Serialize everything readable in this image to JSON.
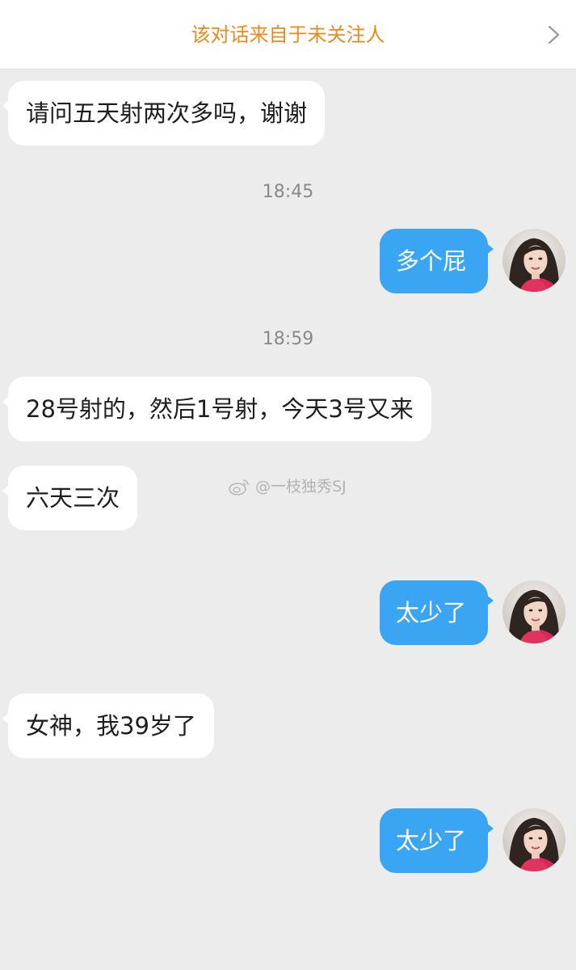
{
  "header": {
    "title": "该对话来自于未关注人",
    "title_color": "#ea8a1c",
    "right_icon": "chevron-right-icon"
  },
  "messages": [
    {
      "side": "incoming",
      "text": "请问五天射两次多吗，谢谢"
    },
    {
      "side": "timestamp",
      "text": "18:45"
    },
    {
      "side": "outgoing",
      "text": "多个屁"
    },
    {
      "side": "timestamp",
      "text": "18:59"
    },
    {
      "side": "incoming",
      "text": "28号射的，然后1号射，今天3号又来"
    },
    {
      "side": "incoming",
      "text": "六天三次"
    },
    {
      "side": "outgoing",
      "text": "太少了"
    },
    {
      "side": "incoming",
      "text": "女神，我39岁了"
    },
    {
      "side": "outgoing",
      "text": "太少了"
    }
  ],
  "watermark": {
    "text": "@一枝独秀SJ",
    "icon": "weibo-icon"
  },
  "colors": {
    "background": "#ececec",
    "incoming_bubble": "#ffffff",
    "outgoing_bubble": "#3aa5f2",
    "timestamp_text": "#8a8a8a"
  }
}
